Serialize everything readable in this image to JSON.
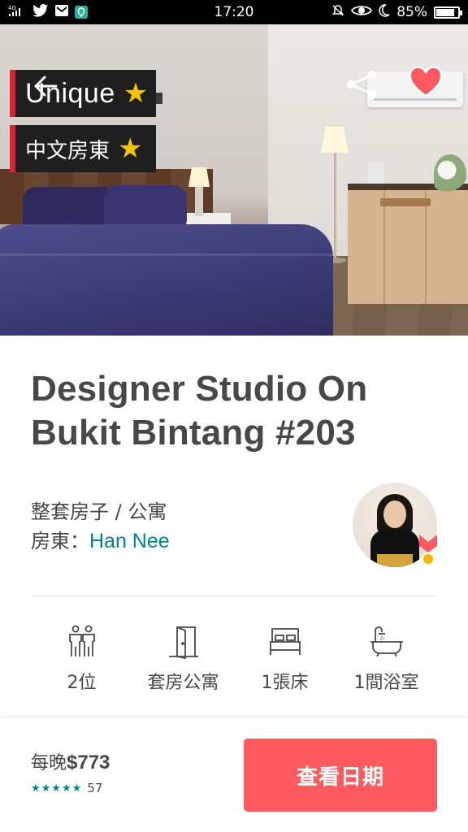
{
  "status_bar": {
    "network": "4G",
    "time": "17:20",
    "battery_percent": "85%",
    "battery_level": 0.85,
    "icons": [
      "signal-icon",
      "twitter-icon",
      "mail-icon",
      "location-app-icon",
      "mute-icon",
      "eye-icon",
      "moon-icon",
      "battery-icon"
    ]
  },
  "hero": {
    "badges": [
      {
        "label": "Unique",
        "star": "★"
      },
      {
        "label": "中文房東",
        "star": "★"
      }
    ],
    "badge_accent": "#d9232e",
    "star_color": "#f5c300",
    "favorite_color": "#ff5a5f"
  },
  "listing": {
    "title": "Designer Studio On Bukit Bintang #203",
    "type": "整套房子 / 公寓",
    "host_prefix": "房東：",
    "host_name": "Han Nee"
  },
  "amenities": [
    {
      "icon": "guests-icon",
      "label": "2位"
    },
    {
      "icon": "door-icon",
      "label": "套房公寓"
    },
    {
      "icon": "bed-icon",
      "label": "1張床"
    },
    {
      "icon": "bathtub-icon",
      "label": "1間浴室"
    }
  ],
  "footer": {
    "price_prefix": "每晚",
    "price": "$773",
    "stars": "★★★★★",
    "review_count": "57",
    "cta_label": "查看日期",
    "cta_color": "#ff5a5f",
    "accent_teal": "#008489"
  }
}
